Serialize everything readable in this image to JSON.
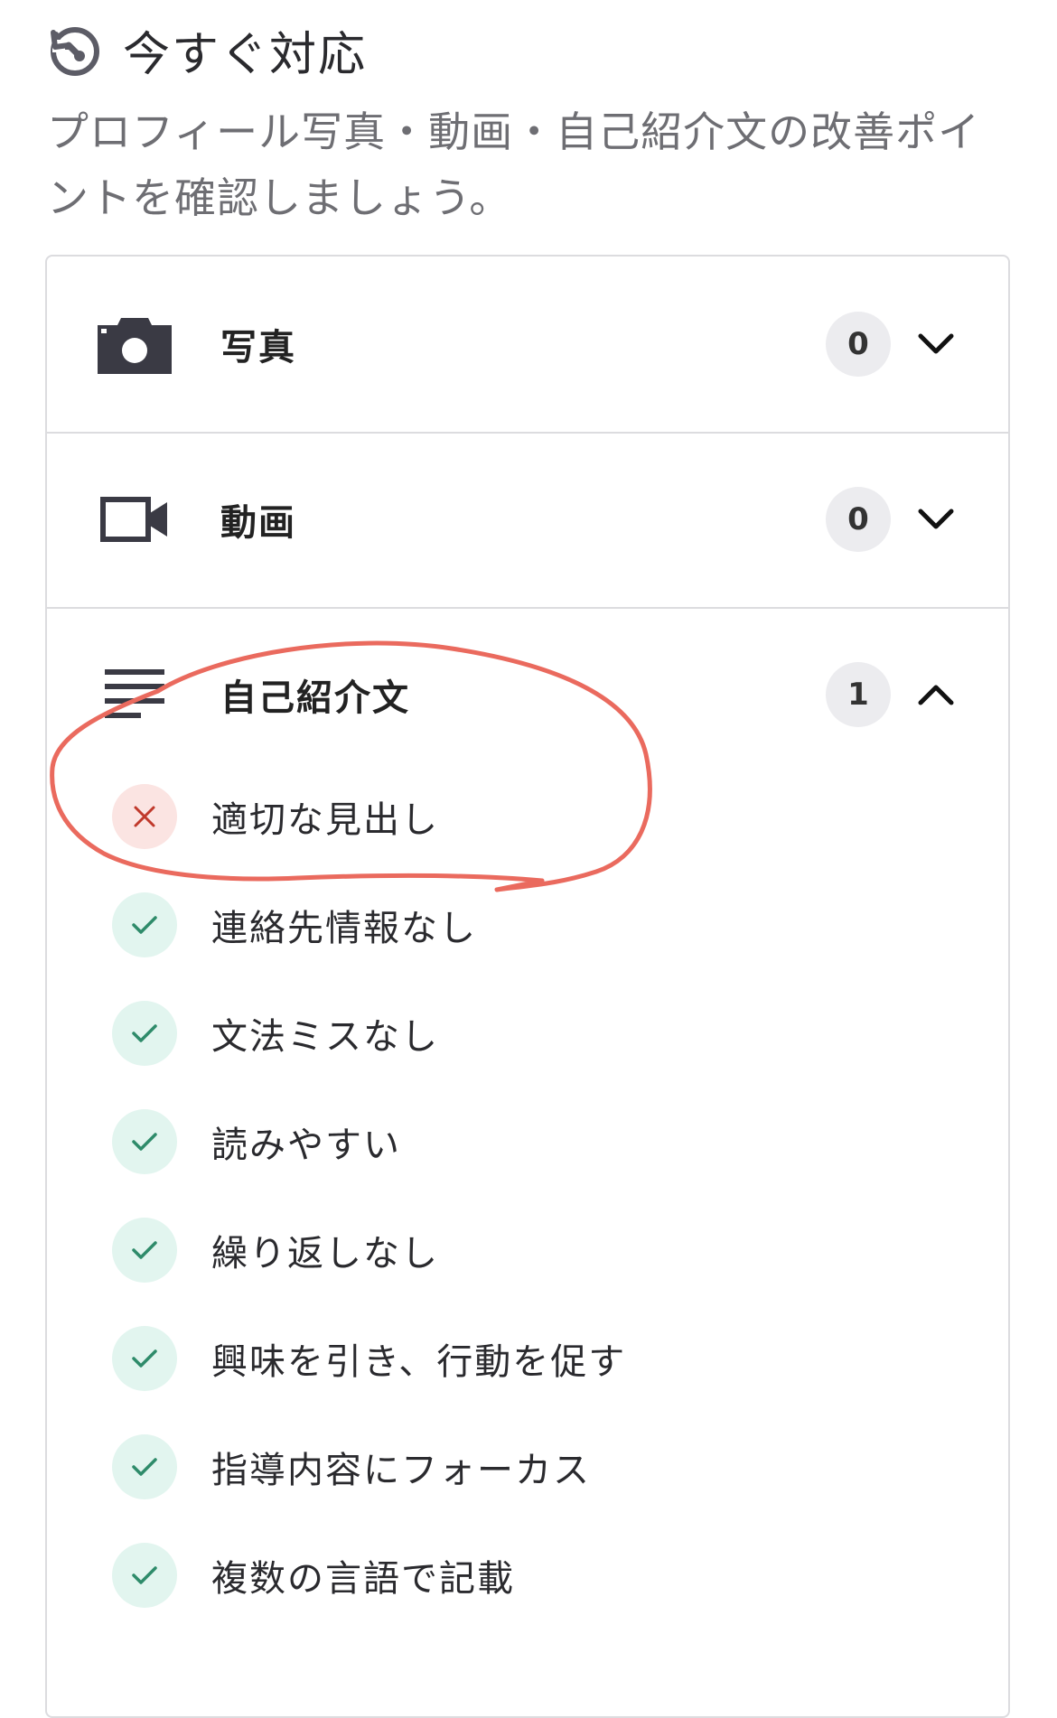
{
  "header": {
    "title": "今すぐ対応",
    "title_icon": "history-clock-icon",
    "subtitle": "プロフィール写真・動画・自己紹介文の改善ポイントを確認しましょう。"
  },
  "sections": [
    {
      "label": "写真",
      "icon": "camera-icon",
      "count": "0",
      "expanded": false
    },
    {
      "label": "動画",
      "icon": "video-camera-icon",
      "count": "0",
      "expanded": false
    },
    {
      "label": "自己紹介文",
      "icon": "text-lines-icon",
      "count": "1",
      "expanded": true
    }
  ],
  "checklist": [
    {
      "label": "適切な見出し",
      "status": "fail"
    },
    {
      "label": "連絡先情報なし",
      "status": "pass"
    },
    {
      "label": "文法ミスなし",
      "status": "pass"
    },
    {
      "label": "読みやすい",
      "status": "pass"
    },
    {
      "label": "繰り返しなし",
      "status": "pass"
    },
    {
      "label": "興味を引き、行動を促す",
      "status": "pass"
    },
    {
      "label": "指導内容にフォーカス",
      "status": "pass"
    },
    {
      "label": "複数の言語で記載",
      "status": "pass"
    }
  ],
  "colors": {
    "pass_icon": "#2e8b6a",
    "pass_bg": "#e2f5ef",
    "fail_icon": "#c0392b",
    "fail_bg": "#fbe4e2",
    "annotation": "#ea6a5e",
    "icon_dark": "#3a3a44"
  }
}
